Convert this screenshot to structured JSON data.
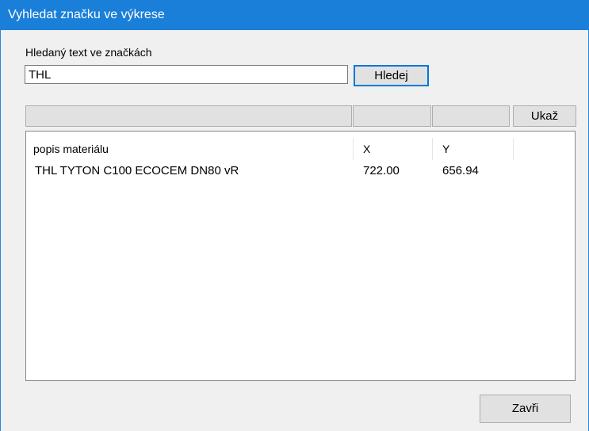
{
  "window": {
    "title": "Vyhledat značku ve výkrese"
  },
  "search": {
    "label": "Hledaný text ve značkách",
    "value": "THL",
    "button_label": "Hledej"
  },
  "filter": {
    "show_button_label": "Ukaž"
  },
  "table": {
    "columns": [
      "popis materiálu",
      "X",
      "Y"
    ],
    "rows": [
      {
        "description": "THL TYTON C100 ECOCEM DN80 vR",
        "x": "722.00",
        "y": "656.94"
      }
    ]
  },
  "footer": {
    "close_label": "Zavři"
  },
  "colors": {
    "titlebar": "#1a7fd9",
    "accent": "#0078d7"
  }
}
